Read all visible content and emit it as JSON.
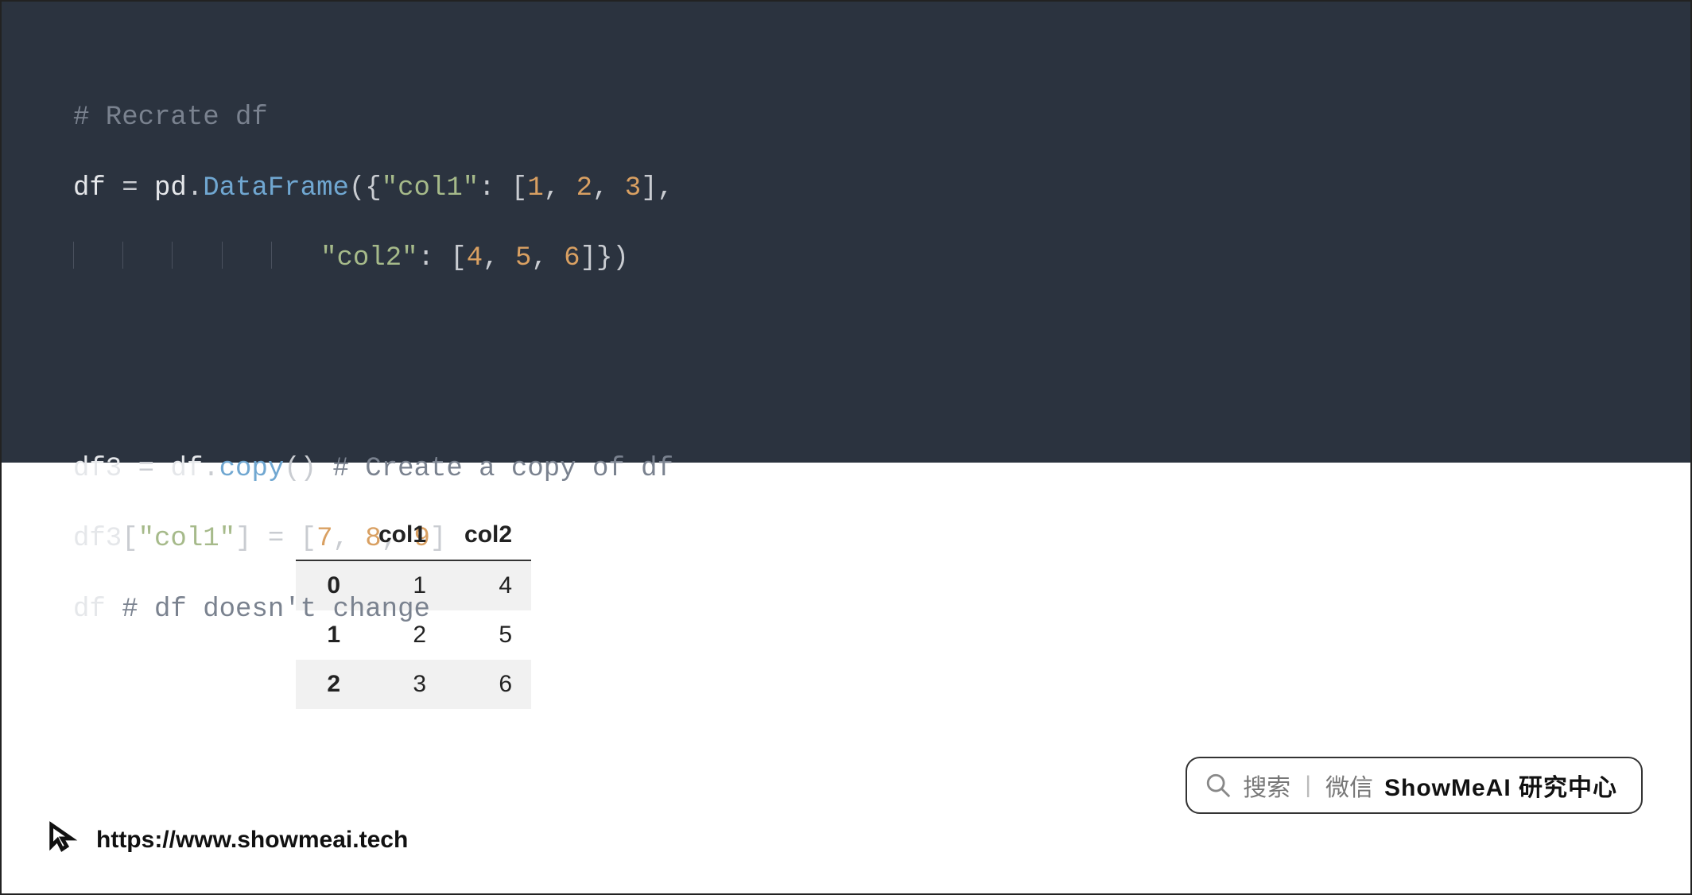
{
  "code": {
    "line1_comment": "# Recrate df",
    "line2_var": "df",
    "line2_eq": " = ",
    "line2_obj": "pd",
    "line2_dot": ".",
    "line2_method": "DataFrame",
    "line2_open": "({",
    "line2_str1": "\"col1\"",
    "line2_colon1": ": [",
    "line2_n1": "1",
    "line2_c1": ", ",
    "line2_n2": "2",
    "line2_c2": ", ",
    "line2_n3": "3",
    "line2_close1": "],",
    "line3_indent": "                   ",
    "line3_str2": "\"col2\"",
    "line3_colon2": ": [",
    "line3_n4": "4",
    "line3_c3": ", ",
    "line3_n5": "5",
    "line3_c4": ", ",
    "line3_n6": "6",
    "line3_close2": "]})",
    "line5_var": "df3",
    "line5_eq": " = ",
    "line5_obj": "df",
    "line5_dot": ".",
    "line5_method": "copy",
    "line5_call": "() ",
    "line5_comment": "# Create a copy of df",
    "line6_var": "df3",
    "line6_idx1": "[",
    "line6_str": "\"col1\"",
    "line6_idx2": "]",
    "line6_eq": " = [",
    "line6_n1": "7",
    "line6_c1": ", ",
    "line6_n2": "8",
    "line6_c2": ", ",
    "line6_n3": "9",
    "line6_close": "]",
    "line7_var": "df ",
    "line7_comment": "# df doesn't change"
  },
  "table": {
    "columns": [
      "col1",
      "col2"
    ],
    "index": [
      "0",
      "1",
      "2"
    ],
    "rows": [
      [
        "1",
        "4"
      ],
      [
        "2",
        "5"
      ],
      [
        "3",
        "6"
      ]
    ]
  },
  "search": {
    "label_search": "搜索",
    "label_wechat": "微信",
    "brand": "ShowMeAI 研究中心"
  },
  "footer": {
    "url": "https://www.showmeai.tech"
  }
}
